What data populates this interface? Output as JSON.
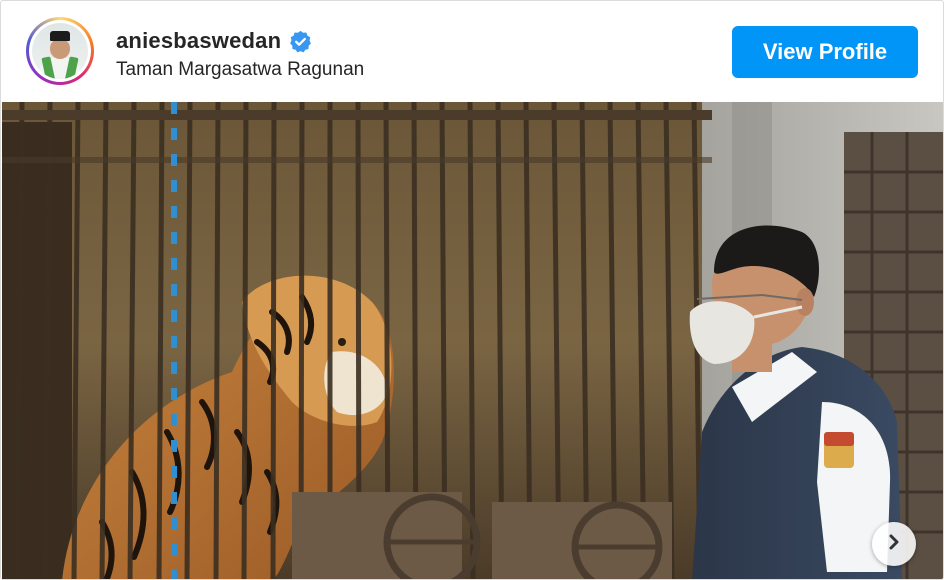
{
  "post": {
    "username": "aniesbaswedan",
    "verified": true,
    "location": "Taman Margasatwa Ragunan",
    "view_profile_label": "View Profile"
  },
  "icons": {
    "verified": "verified-badge-icon",
    "next": "chevron-right-icon"
  },
  "colors": {
    "button_blue": "#0095f6",
    "verified_blue": "#3897f0",
    "text": "#262626"
  }
}
